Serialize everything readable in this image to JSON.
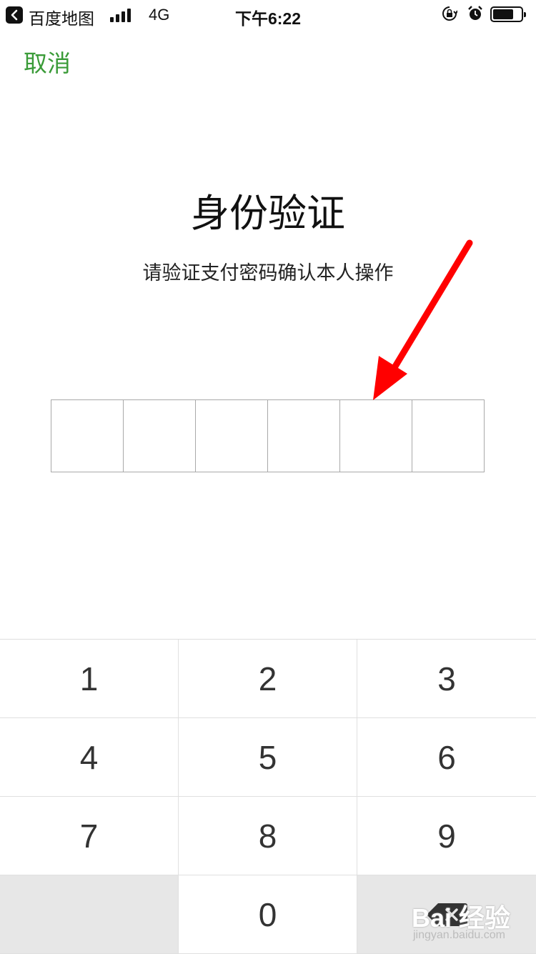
{
  "status_bar": {
    "back_app": "百度地图",
    "network": "4G",
    "time": "下午6:22",
    "icons": [
      "chevron-left-icon",
      "signal-icon",
      "rotation-lock-icon",
      "alarm-icon",
      "battery-icon"
    ]
  },
  "header": {
    "cancel_label": "取消"
  },
  "main": {
    "title": "身份验证",
    "subtitle": "请验证支付密码确认本人操作",
    "password_length": 6
  },
  "keypad": {
    "keys": [
      "1",
      "2",
      "3",
      "4",
      "5",
      "6",
      "7",
      "8",
      "9",
      "",
      "0",
      "delete"
    ]
  },
  "watermark": {
    "main": "Bai 经验",
    "sub": "jingyan.baidu.com"
  },
  "colors": {
    "accent": "#3a9b38",
    "arrow": "#ff0000",
    "key_bg_dark": "#e7e7e7"
  }
}
